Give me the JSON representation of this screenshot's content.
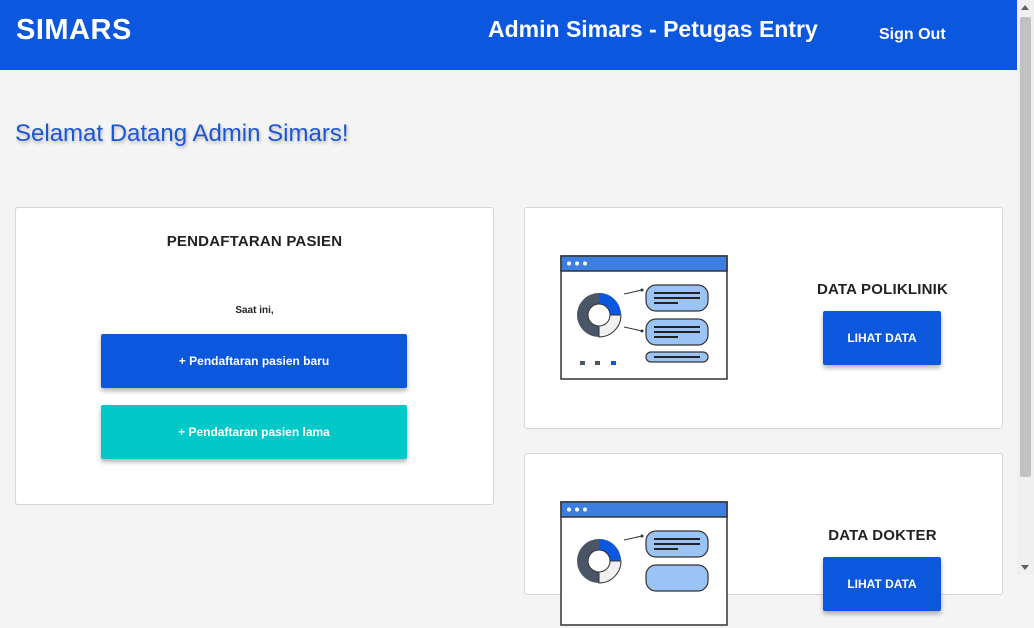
{
  "navbar": {
    "brand": "SIMARS",
    "title": "Admin Simars - Petugas Entry",
    "sign_out": "Sign Out"
  },
  "welcome": "Selamat Datang Admin Simars!",
  "pendaftaran": {
    "title": "PENDAFTARAN PASIEN",
    "subtitle": "Saat ini,",
    "btn_baru": "+ Pendaftaran pasien baru",
    "btn_lama": "+ Pendaftaran pasien lama"
  },
  "poliklinik": {
    "title": "DATA POLIKLINIK",
    "button": "LIHAT DATA"
  },
  "dokter": {
    "title": "DATA DOKTER",
    "button": "LIHAT DATA"
  },
  "colors": {
    "primary": "#0b57de",
    "secondary": "#00c9c8",
    "background": "#f4f4f4"
  }
}
